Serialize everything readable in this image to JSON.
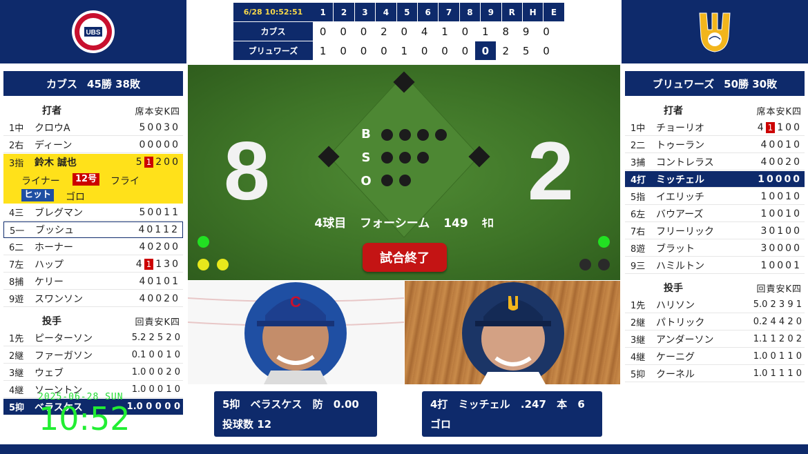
{
  "scoreboard": {
    "datetime": "6/28 10:52:51",
    "innings": [
      "1",
      "2",
      "3",
      "4",
      "5",
      "6",
      "7",
      "8",
      "9",
      "R",
      "H",
      "E"
    ],
    "teams": [
      {
        "name": "カブス",
        "scores": [
          "0",
          "0",
          "0",
          "2",
          "0",
          "4",
          "1",
          "0",
          "1",
          "8",
          "9",
          "0"
        ]
      },
      {
        "name": "ブリュワーズ",
        "scores": [
          "1",
          "0",
          "0",
          "0",
          "1",
          "0",
          "0",
          "0",
          "0",
          "2",
          "5",
          "0"
        ]
      }
    ]
  },
  "left": {
    "team": "カブス",
    "record": "45勝 38敗",
    "batters_head": "打者",
    "batters_cols": "席本安K四",
    "batters": [
      {
        "pos": "1中",
        "name": "クロウA",
        "stats": "50030"
      },
      {
        "pos": "2右",
        "name": "ディーン",
        "stats": "00000"
      },
      {
        "pos": "3指",
        "name": "鈴木 誠也",
        "stats_pre": "5",
        "stats_hit": "1",
        "stats_post": "200"
      },
      {
        "pos": "4三",
        "name": "ブレグマン",
        "stats": "50011"
      },
      {
        "pos": "5一",
        "name": "ブッシュ",
        "stats": "40112"
      },
      {
        "pos": "6二",
        "name": "ホーナー",
        "stats": "40200"
      },
      {
        "pos": "7左",
        "name": "ハップ",
        "stats_pre": "4",
        "stats_hit": "1",
        "stats_post": "130"
      },
      {
        "pos": "8捕",
        "name": "ケリー",
        "stats": "40101"
      },
      {
        "pos": "9遊",
        "name": "スワンソン",
        "stats": "40020"
      }
    ],
    "result_sub": {
      "liner": "ライナー",
      "hr_tag": "12号",
      "fly": "フライ",
      "hit_tag": "ヒット",
      "grounder": "ゴロ"
    },
    "pitchers_head": "投手",
    "pitchers_cols": "回責安K四",
    "pitchers": [
      {
        "pos": "1先",
        "name": "ピーターソン",
        "stats": "5.2 2 5 2 0"
      },
      {
        "pos": "2継",
        "name": "ファーガソン",
        "stats": "0.1 0 0 1 0"
      },
      {
        "pos": "3継",
        "name": "ウェブ",
        "stats": "1.0 0 0 2 0"
      },
      {
        "pos": "4継",
        "name": "ソーントン",
        "stats": "1.0 0 0 1 0"
      },
      {
        "pos": "5抑",
        "name": "ベラスケス",
        "stats": "1.0 0 0 0 0"
      }
    ]
  },
  "right": {
    "team": "ブリュワーズ",
    "record": "50勝 30敗",
    "batters_head": "打者",
    "batters_cols": "席本安K四",
    "batters": [
      {
        "pos": "1中",
        "name": "チョーリオ",
        "stats_pre": "4",
        "stats_hit": "1",
        "stats_post": "100"
      },
      {
        "pos": "2二",
        "name": "トゥーラン",
        "stats": "40010"
      },
      {
        "pos": "3捕",
        "name": "コントレラス",
        "stats": "40020"
      },
      {
        "pos": "4打",
        "name": "ミッチェル",
        "stats": "10000"
      },
      {
        "pos": "5指",
        "name": "イエリッチ",
        "stats": "10010"
      },
      {
        "pos": "6左",
        "name": "バウアーズ",
        "stats": "10010"
      },
      {
        "pos": "7右",
        "name": "フリーリック",
        "stats": "30100"
      },
      {
        "pos": "8遊",
        "name": "ブラット",
        "stats": "30000"
      },
      {
        "pos": "9三",
        "name": "ハミルトン",
        "stats": "10001"
      }
    ],
    "pitchers_head": "投手",
    "pitchers_cols": "回責安K四",
    "pitchers": [
      {
        "pos": "1先",
        "name": "ハリソン",
        "stats": "5.0 2 3 9 1"
      },
      {
        "pos": "2継",
        "name": "パトリック",
        "stats": "0.2 4 4 2 0"
      },
      {
        "pos": "3継",
        "name": "アンダーソン",
        "stats": "1.1 1 2 0 2"
      },
      {
        "pos": "4継",
        "name": "ケーニグ",
        "stats": "1.0 0 1 1 0"
      },
      {
        "pos": "5抑",
        "name": "クーネル",
        "stats": "1.0 1 1 1 0"
      }
    ]
  },
  "field": {
    "score_left": "8",
    "score_right": "2",
    "bso": [
      "B",
      "S",
      "O"
    ],
    "pitch_info": "4球目 フォーシーム 149 ｷﾛ",
    "end_label": "試合終了"
  },
  "cards": {
    "pitcher": {
      "line1": "5抑 ベラスケス 防 0.00",
      "line2": "投球数 12"
    },
    "batter": {
      "line1": "4打 ミッチェル .247 本 6",
      "line2": "ゴロ"
    }
  },
  "overlay": {
    "date": "2025-06-28 SUN",
    "time": "10:52"
  },
  "colors": {
    "navy": "#0e2a6b",
    "yellow": "#ffe11a",
    "red": "#c41414",
    "field": "#3e7427",
    "clock": "#22ee33"
  }
}
